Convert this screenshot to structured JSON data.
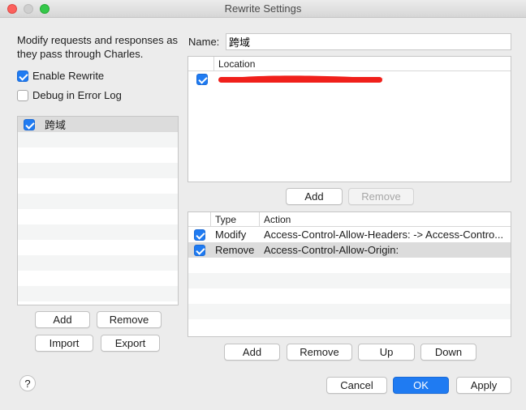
{
  "window": {
    "title": "Rewrite Settings"
  },
  "left": {
    "description": "Modify requests and responses as they pass through Charles.",
    "enable_rewrite": {
      "label": "Enable Rewrite",
      "checked": true
    },
    "debug_log": {
      "label": "Debug in Error Log",
      "checked": false
    },
    "sets": [
      {
        "name": "跨域",
        "checked": true
      }
    ],
    "buttons": {
      "add": "Add",
      "remove": "Remove",
      "import": "Import",
      "export": "Export"
    }
  },
  "name": {
    "label": "Name:",
    "value": "跨域"
  },
  "locations": {
    "header": "Location",
    "items": [
      {
        "checked": true
      }
    ],
    "buttons": {
      "add": "Add",
      "remove": "Remove"
    }
  },
  "rules": {
    "headers": {
      "type": "Type",
      "action": "Action"
    },
    "items": [
      {
        "checked": true,
        "type": "Modify",
        "action": "Access-Control-Allow-Headers: -> Access-Contro..."
      },
      {
        "checked": true,
        "type": "Remove",
        "action": "Access-Control-Allow-Origin:"
      }
    ],
    "buttons": {
      "add": "Add",
      "remove": "Remove",
      "up": "Up",
      "down": "Down"
    }
  },
  "footer": {
    "help": "?",
    "cancel": "Cancel",
    "ok": "OK",
    "apply": "Apply"
  },
  "colors": {
    "accent": "#1f7bf2",
    "redaction": "#f0201b"
  }
}
